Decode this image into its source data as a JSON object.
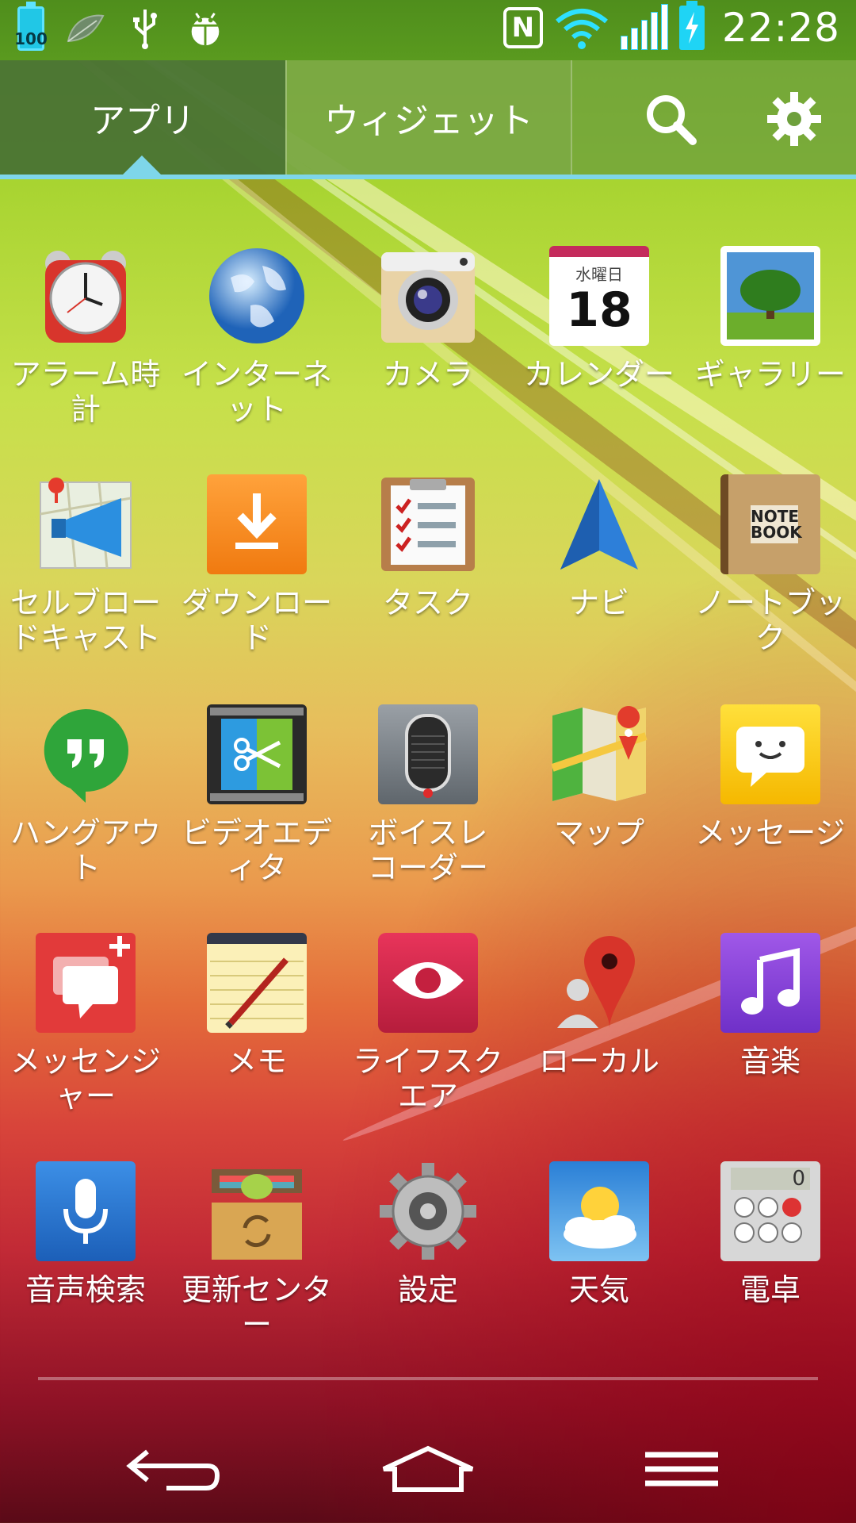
{
  "status_bar": {
    "battery_percent_label": "100",
    "nfc_label": "N",
    "time": "22:28"
  },
  "tabs": {
    "apps": "アプリ",
    "widgets": "ウィジェット"
  },
  "apps": [
    {
      "label": "アラーム時計",
      "icon": "alarm-clock-icon"
    },
    {
      "label": "インターネット",
      "icon": "globe-icon"
    },
    {
      "label": "カメラ",
      "icon": "camera-icon"
    },
    {
      "label": "カレンダー",
      "icon": "calendar-icon",
      "icon_text_top": "水曜日",
      "icon_text_day": "18"
    },
    {
      "label": "ギャラリー",
      "icon": "gallery-icon"
    },
    {
      "label": "セルブロー\nドキャスト",
      "icon": "cell-broadcast-icon"
    },
    {
      "label": "ダウンロード",
      "icon": "download-icon"
    },
    {
      "label": "タスク",
      "icon": "tasks-icon"
    },
    {
      "label": "ナビ",
      "icon": "navigation-icon"
    },
    {
      "label": "ノートブック",
      "icon": "notebook-icon",
      "icon_text": "NOTE BOOK"
    },
    {
      "label": "ハングアウト",
      "icon": "hangouts-icon"
    },
    {
      "label": "ビデオエディタ",
      "icon": "video-editor-icon"
    },
    {
      "label": "ボイスレ\nコーダー",
      "icon": "voice-recorder-icon"
    },
    {
      "label": "マップ",
      "icon": "maps-icon"
    },
    {
      "label": "メッセージ",
      "icon": "message-icon"
    },
    {
      "label": "メッセンジャー",
      "icon": "messenger-icon"
    },
    {
      "label": "メモ",
      "icon": "memo-icon"
    },
    {
      "label": "ライフスクエア",
      "icon": "lifesquare-icon"
    },
    {
      "label": "ローカル",
      "icon": "local-icon"
    },
    {
      "label": "音楽",
      "icon": "music-icon"
    },
    {
      "label": "音声検索",
      "icon": "voice-search-icon"
    },
    {
      "label": "更新センター",
      "icon": "update-center-icon"
    },
    {
      "label": "設定",
      "icon": "settings-icon"
    },
    {
      "label": "天気",
      "icon": "weather-icon"
    },
    {
      "label": "電卓",
      "icon": "calculator-icon",
      "icon_text": "0"
    }
  ],
  "colors": {
    "accent_line": "#7ed6ea",
    "status_bar": "#5a9a1f"
  }
}
